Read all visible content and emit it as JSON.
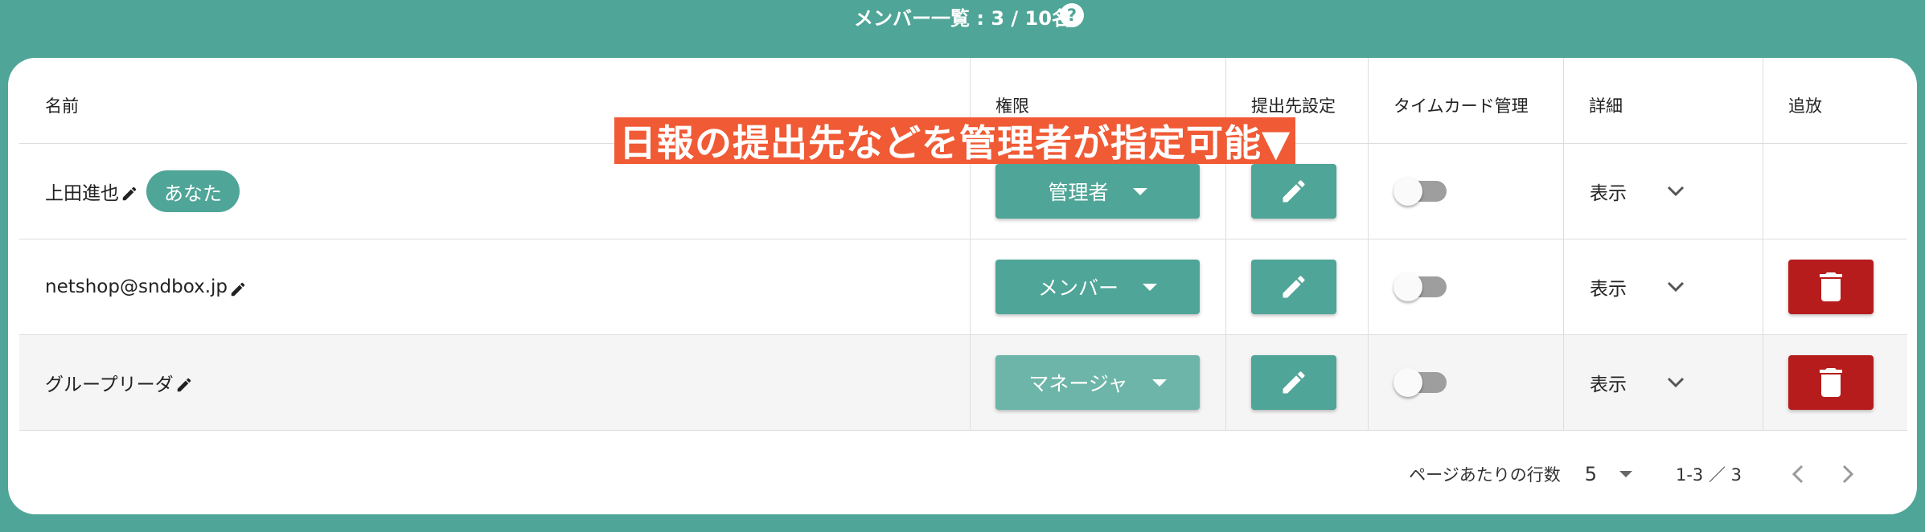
{
  "header": {
    "title": "メンバー一覧 : 3 / 10名",
    "help_glyph": "?"
  },
  "annotation": "日報の提出先などを管理者が指定可能▼",
  "table": {
    "columns": [
      "名前",
      "権限",
      "提出先設定",
      "タイムカード管理",
      "詳細",
      "追放"
    ],
    "rows": [
      {
        "name": "上田進也",
        "badge": "あなた",
        "role": "管理者",
        "timecard": false,
        "detail": "表示",
        "deletable": false
      },
      {
        "name": "netshop@sndbox.jp",
        "role": "メンバー",
        "timecard": false,
        "detail": "表示",
        "deletable": true
      },
      {
        "name": "グループリーダ",
        "role": "マネージャ",
        "timecard": false,
        "detail": "表示",
        "deletable": true
      }
    ]
  },
  "pagination": {
    "rows_label": "ページあたりの行数",
    "rows_value": "5",
    "range": "1-3 ／ 3"
  },
  "colors": {
    "accent": "#4fa597",
    "danger": "#b71c1c",
    "annotation": "#f05a35"
  }
}
